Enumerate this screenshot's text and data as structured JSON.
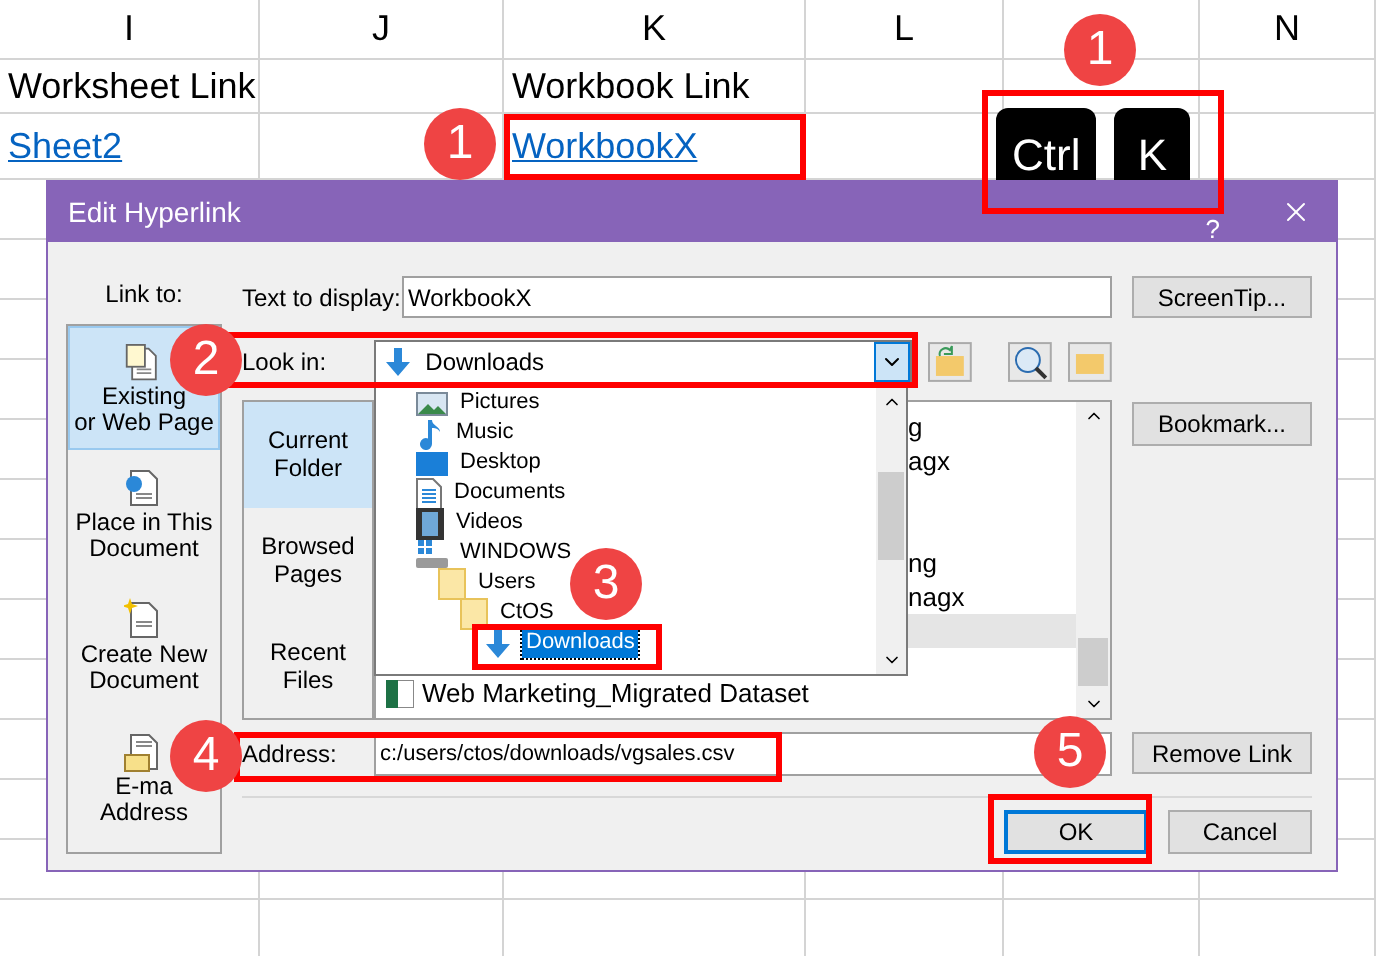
{
  "sheet": {
    "columns": [
      {
        "kind": "letter",
        "label": "I"
      },
      {
        "kind": "letter",
        "label": "J"
      },
      {
        "kind": "letter",
        "label": "K"
      },
      {
        "kind": "letter",
        "label": "L"
      },
      {
        "kind": "covered"
      },
      {
        "kind": "letter",
        "label": "N"
      }
    ],
    "rows": [
      {
        "cells": [
          {
            "kind": "text",
            "text": "Worksheet Link"
          },
          {
            "kind": "empty"
          },
          {
            "kind": "text",
            "text": "Workbook Link"
          },
          {
            "kind": "empty"
          },
          {
            "kind": "empty"
          },
          {
            "kind": "empty"
          }
        ]
      },
      {
        "cells": [
          {
            "kind": "link",
            "text": "Sheet2"
          },
          {
            "kind": "empty"
          },
          {
            "kind": "link",
            "text": "WorkbookX"
          },
          {
            "kind": "empty"
          },
          {
            "kind": "empty"
          },
          {
            "kind": "empty"
          }
        ]
      }
    ]
  },
  "keys": [
    "Ctrl",
    "K"
  ],
  "badges": [
    "1",
    "1",
    "2",
    "3",
    "4",
    "5"
  ],
  "dialog": {
    "title": "Edit Hyperlink",
    "help": "?",
    "link_to": {
      "label": "Link to:",
      "items": [
        {
          "kind": "file",
          "lines": [
            "Existing",
            "or Web Page"
          ],
          "selected": true
        },
        {
          "kind": "place",
          "lines": [
            "Place in This",
            "Document"
          ],
          "selected": false
        },
        {
          "kind": "new",
          "lines": [
            "Create New",
            "Document"
          ],
          "selected": false
        },
        {
          "kind": "email",
          "lines": [
            "E-ma",
            "Address"
          ],
          "selected": false
        }
      ]
    },
    "text_to_display": {
      "label": "Text to display:",
      "value": "WorkbookX"
    },
    "screentip": "ScreenTip...",
    "look_in": {
      "label": "Look in:",
      "value": "Downloads"
    },
    "nav": [
      {
        "label": "Current Folder",
        "selected": true
      },
      {
        "label": "Browsed Pages",
        "selected": false
      },
      {
        "label": "Recent Files",
        "selected": false
      }
    ],
    "files": [
      {
        "kind": "fragment",
        "text": "g",
        "selected": false
      },
      {
        "kind": "fragment",
        "text": "agx",
        "selected": false
      },
      {
        "kind": "blank",
        "selected": false
      },
      {
        "kind": "blank",
        "selected": false
      },
      {
        "kind": "fragment",
        "text": "ng",
        "selected": false
      },
      {
        "kind": "fragment",
        "text": "nagx",
        "selected": false
      },
      {
        "kind": "blank",
        "selected": true
      },
      {
        "kind": "file",
        "text": "Web Marketing_Migrated Dataset",
        "selected": false
      }
    ],
    "dropdown": [
      {
        "kind": "pictures",
        "label": "Pictures",
        "selected": false
      },
      {
        "kind": "music",
        "label": "Music",
        "selected": false
      },
      {
        "kind": "desktop",
        "label": "Desktop",
        "selected": false
      },
      {
        "kind": "documents",
        "label": "Documents",
        "selected": false
      },
      {
        "kind": "videos",
        "label": "Videos",
        "selected": false
      },
      {
        "kind": "drive",
        "label": "WINDOWS",
        "selected": false,
        "children": [
          {
            "kind": "folder",
            "label": "Users",
            "selected": false,
            "children": [
              {
                "kind": "folder",
                "label": "CtOS",
                "selected": false,
                "children": [
                  {
                    "kind": "downloads",
                    "label": "Downloads",
                    "selected": true
                  }
                ]
              }
            ]
          }
        ]
      }
    ],
    "bookmark": "Bookmark...",
    "address": {
      "label": "Address:",
      "value": "c:/users/ctos/downloads/vgsales.csv"
    },
    "remove_link": "Remove Link",
    "ok": "OK",
    "cancel": "Cancel"
  }
}
